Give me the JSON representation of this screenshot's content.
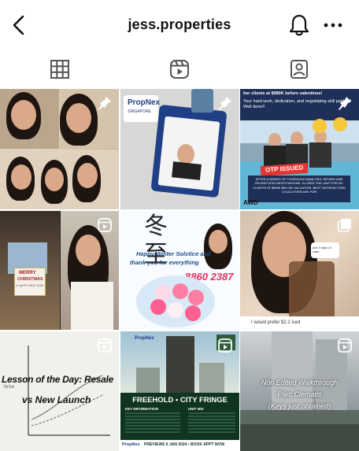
{
  "header": {
    "username": "jess.properties"
  },
  "tabs": [
    {
      "name": "grid-tab",
      "icon": "grid-icon",
      "active": true
    },
    {
      "name": "reels-tab",
      "icon": "reels-icon",
      "active": false
    },
    {
      "name": "tagged-tab",
      "icon": "tagged-icon",
      "active": false
    }
  ],
  "posts": [
    {
      "id": "p1",
      "badge": "pin-icon",
      "texts": []
    },
    {
      "id": "p2",
      "badge": "pin-icon",
      "texts": [
        "PropNex",
        "SINGAPORE"
      ]
    },
    {
      "id": "p3",
      "badge": "pin-icon",
      "texts": [
        "her clients at $980K before valentines!",
        "Your hard work, dedication, and negotiating skill paid off! Well done!!",
        "OTP ISSUED",
        "AFTER A SERIES OF THOROUGH ANALYSIS, REVIEW AND RELENTLESS NEGOTIATIONS, CLOSED THE UNIT FOR MY CLIENTS AT $980K BELOW VALUATION. BEST SATISFACTION! COULD EVER ASK FOR",
        "AWD"
      ]
    },
    {
      "id": "p4",
      "badge": "reel-icon",
      "texts": [
        "MERRY",
        "CHRISTMAS",
        "& HAPPY NEW YEAR"
      ]
    },
    {
      "id": "p5",
      "badge": "none",
      "texts": [
        "Happy Winter Solstice and",
        "thank you for everything",
        "8860 2387"
      ]
    },
    {
      "id": "p6",
      "badge": "multi-icon",
      "texts": [
        "I would prefer $2.2 iced",
        "just 3 days of cake"
      ]
    },
    {
      "id": "p7",
      "badge": "reel-icon",
      "texts": [
        "Lesson of the Day: Resale",
        "vs New Launch",
        "TikTok"
      ]
    },
    {
      "id": "p8",
      "badge": "reel-icon",
      "texts": [
        "PropNex",
        "FREEHOLD • CITY FRINGE",
        "KEY INFORMATION",
        "UNIT MIX",
        "PREVIEWS 6 JAN 2024 • BOOK APPT NOW",
        "PropNex"
      ]
    },
    {
      "id": "p9",
      "badge": "reel-icon",
      "texts": [
        "Non Edited Walkthrough",
        "Parc Clematis",
        "(Keys just obtained)"
      ]
    }
  ]
}
